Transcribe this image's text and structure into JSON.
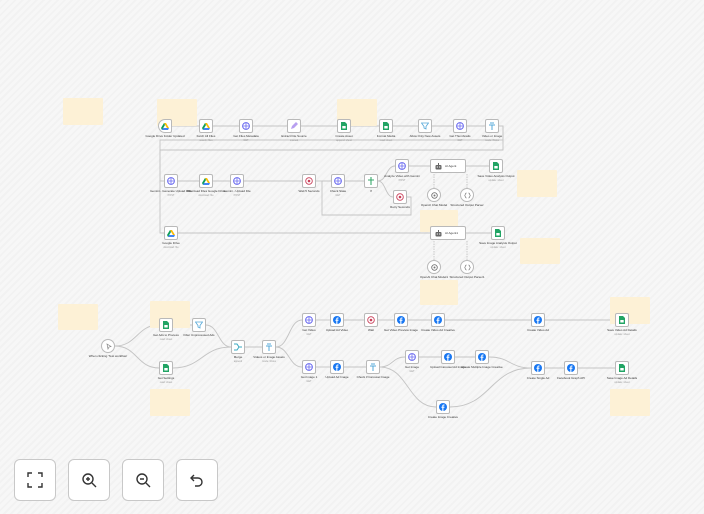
{
  "colors": {
    "sticky": "#fdf1d6",
    "edge": "#c4c4c4",
    "facebook": "#1877f2",
    "sheets": "#21a464",
    "http": "#6b6bf0",
    "wait": "#c9405a"
  },
  "nodes": [
    {
      "label": "Google Drive Folder Updated",
      "sub": "",
      "icon": "google-drive-icon"
    },
    {
      "label": "Fetch All Files",
      "sub": "search: files",
      "icon": "google-drive-icon"
    },
    {
      "label": "Get Files Metadata",
      "sub": "GET",
      "icon": "http-globe-icon"
    },
    {
      "label": "Extract File Source",
      "sub": "manual",
      "icon": "edit-pen-icon"
    },
    {
      "label": "Create Asset",
      "sub": "append: sheet",
      "icon": "google-sheets-icon"
    },
    {
      "label": "Format Media",
      "sub": "read: sheet",
      "icon": "google-sheets-icon"
    },
    {
      "label": "Allow Only New Assets",
      "sub": "",
      "icon": "filter-icon"
    },
    {
      "label": "Get Thumbnails",
      "sub": "GET",
      "icon": "http-globe-icon"
    },
    {
      "label": "Video or Image",
      "sub": "mode: Rules",
      "icon": "switch-icon"
    },
    {
      "label": "Gemini - Generate Upload URL",
      "sub": "POST",
      "icon": "http-globe-icon"
    },
    {
      "label": "Download Files Google Drive",
      "sub": "download: file",
      "icon": "google-drive-icon"
    },
    {
      "label": "Gemini - Upload File",
      "sub": "POST",
      "icon": "http-globe-icon"
    },
    {
      "label": "Wait 5 Seconds",
      "sub": "",
      "icon": "wait-icon"
    },
    {
      "label": "Check State",
      "sub": "GET",
      "icon": "http-globe-icon"
    },
    {
      "label": "If",
      "sub": "",
      "icon": "if-icon"
    },
    {
      "label": "Analyze Video with Gemini",
      "sub": "POST",
      "icon": "http-globe-icon"
    },
    {
      "label": "Retry Seconds",
      "sub": "",
      "icon": "wait-icon"
    },
    {
      "label": "AI Agent",
      "sub": "",
      "icon": "robot-icon"
    },
    {
      "label": "Save Video Analysis Output",
      "sub": "update: sheet",
      "icon": "google-sheets-icon"
    },
    {
      "label": "OpenAI Chat Model",
      "sub": "",
      "icon": "openai-icon"
    },
    {
      "label": "Structured Output Parser",
      "sub": "",
      "icon": "parser-icon"
    },
    {
      "label": "Google Drive",
      "sub": "download: file",
      "icon": "google-drive-icon"
    },
    {
      "label": "AI Agent1",
      "sub": "",
      "icon": "robot-icon"
    },
    {
      "label": "Save Image Analysis Output",
      "sub": "update: sheet",
      "icon": "google-sheets-icon"
    },
    {
      "label": "OpenAI Chat Model1",
      "sub": "",
      "icon": "openai-icon"
    },
    {
      "label": "Structured Output Parser1",
      "sub": "",
      "icon": "parser-icon"
    },
    {
      "label": "When clicking 'Test workflow'",
      "sub": "",
      "icon": "cursor-click-icon"
    },
    {
      "label": "Get Ads to Process",
      "sub": "read: sheet",
      "icon": "google-sheets-icon"
    },
    {
      "label": "Filter Unprocessed Ads",
      "sub": "",
      "icon": "filter-icon"
    },
    {
      "label": "Get Settings",
      "sub": "read: sheet",
      "icon": "google-sheets-icon"
    },
    {
      "label": "Merge",
      "sub": "append",
      "icon": "merge-icon"
    },
    {
      "label": "Videos or Image Assets",
      "sub": "mode: Rules",
      "icon": "switch-icon"
    },
    {
      "label": "Get Video",
      "sub": "GET",
      "icon": "http-globe-icon"
    },
    {
      "label": "Upload Ad Video",
      "sub": "",
      "icon": "facebook-icon"
    },
    {
      "label": "Wait",
      "sub": "",
      "icon": "wait-icon"
    },
    {
      "label": "Get Video Preview Image",
      "sub": "",
      "icon": "facebook-icon"
    },
    {
      "label": "Create Video Ad Creative",
      "sub": "",
      "icon": "facebook-icon"
    },
    {
      "label": "Create Video Ad",
      "sub": "",
      "icon": "facebook-icon"
    },
    {
      "label": "Save Video Ad Details",
      "sub": "update: sheet",
      "icon": "google-sheets-icon"
    },
    {
      "label": "Get Image 1",
      "sub": "GET",
      "icon": "http-globe-icon"
    },
    {
      "label": "Upload Ad Image",
      "sub": "",
      "icon": "facebook-icon"
    },
    {
      "label": "Check if Carousel Image",
      "sub": "",
      "icon": "switch-icon"
    },
    {
      "label": "Get Image",
      "sub": "GET",
      "icon": "http-globe-icon"
    },
    {
      "label": "Upload Carousel Ad Image",
      "sub": "",
      "icon": "facebook-icon"
    },
    {
      "label": "Create Multiple Image Creative",
      "sub": "",
      "icon": "facebook-icon"
    },
    {
      "label": "Create Single Ad",
      "sub": "",
      "icon": "facebook-icon"
    },
    {
      "label": "Facebook Graph API",
      "sub": "",
      "icon": "facebook-icon"
    },
    {
      "label": "Save Image Ad Details",
      "sub": "update: sheet",
      "icon": "google-sheets-icon"
    },
    {
      "label": "Create Image Creative",
      "sub": "",
      "icon": "facebook-icon"
    }
  ],
  "agent_name": "AI Agent",
  "agent1_name": "AI Agent1",
  "controls": [
    {
      "name": "fit-view",
      "icon": "fit-view-icon"
    },
    {
      "name": "zoom-in",
      "icon": "zoom-in-icon"
    },
    {
      "name": "zoom-out",
      "icon": "zoom-out-icon"
    },
    {
      "name": "undo",
      "icon": "undo-icon"
    }
  ]
}
